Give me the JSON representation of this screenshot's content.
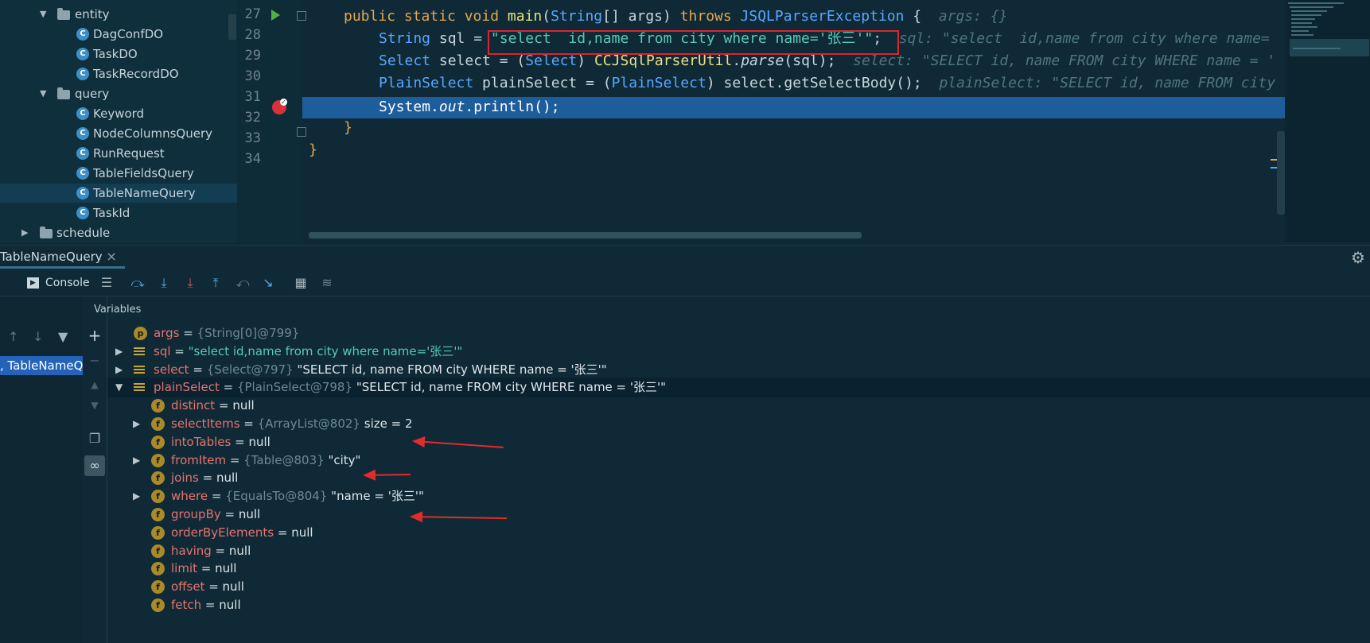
{
  "project_tree": {
    "nodes": [
      {
        "label": "entity",
        "kind": "folder",
        "expanded": true
      },
      {
        "label": "DagConfDO",
        "kind": "class"
      },
      {
        "label": "TaskDO",
        "kind": "class"
      },
      {
        "label": "TaskRecordDO",
        "kind": "class"
      },
      {
        "label": "query",
        "kind": "folder",
        "expanded": true
      },
      {
        "label": "Keyword",
        "kind": "class"
      },
      {
        "label": "NodeColumnsQuery",
        "kind": "class"
      },
      {
        "label": "RunRequest",
        "kind": "class"
      },
      {
        "label": "TableFieldsQuery",
        "kind": "class"
      },
      {
        "label": "TableNameQuery",
        "kind": "class",
        "selected": true
      },
      {
        "label": "TaskId",
        "kind": "class"
      },
      {
        "label": "schedule",
        "kind": "folder",
        "expanded": false
      }
    ]
  },
  "editor": {
    "line_numbers": [
      "27",
      "28",
      "29",
      "30",
      "31",
      "32",
      "33",
      "34"
    ],
    "line27": {
      "kw1": "public static void ",
      "fn": "main",
      "p1": "(",
      "ty": "String",
      "p2": "[] args) ",
      "kw2": "throws ",
      "exc": "JSQLParserException",
      "p3": " {",
      "hint": "args: {}"
    },
    "line28": {
      "ty": "String",
      "p1": " sql = ",
      "str": "\"select  id,name from city where name='张三'\"",
      "p2": ";",
      "hint": "sql: \"select  id,name from city where name="
    },
    "line29": {
      "ty": "Select",
      "p1": " select = (",
      "ty2": "Select",
      "p2": ") ",
      "cls": "CCJSqlParserUtil",
      "p3": ".",
      "m": "parse",
      "p4": "(sql);",
      "hint": "select: \"SELECT id, name FROM city WHERE name = '"
    },
    "line30": {
      "ty": "PlainSelect",
      "p1": " plainSelect = (",
      "ty2": "PlainSelect",
      "p2": ") select.getSelectBody();",
      "hint": "plainSelect: \"SELECT id, name FROM city"
    },
    "line31": {
      "p1": "System.",
      "out": "out",
      "p2": ".println();"
    },
    "line32": "}",
    "line33": "}"
  },
  "debug": {
    "tab_title": "TableNameQuery",
    "tab_close": "×",
    "console_label": "Console",
    "variables_header": "Variables",
    "frame_label": ", TableNameQ",
    "variables": [
      {
        "name": "args",
        "type": "{String[0]@799}",
        "value": "",
        "icon": "p",
        "expandable": false
      },
      {
        "name": "sql",
        "type": "",
        "value": "\"select  id,name from city where name='张三'\"",
        "icon": "local",
        "expandable": true,
        "is_string": true
      },
      {
        "name": "select",
        "type": "{Select@797}",
        "value": "\"SELECT id, name FROM city WHERE name = '张三'\"",
        "icon": "local",
        "expandable": true
      },
      {
        "name": "plainSelect",
        "type": "{PlainSelect@798}",
        "value": "\"SELECT id, name FROM city WHERE name = '张三'\"",
        "icon": "local",
        "expandable": true,
        "expanded": true,
        "selected": true
      },
      {
        "name": "distinct",
        "type": "",
        "value": "null",
        "icon": "f",
        "child": true
      },
      {
        "name": "selectItems",
        "type": "{ArrayList@802}",
        "value": " size = 2",
        "icon": "f",
        "child": true,
        "expandable": true
      },
      {
        "name": "intoTables",
        "type": "",
        "value": "null",
        "icon": "f",
        "child": true
      },
      {
        "name": "fromItem",
        "type": "{Table@803}",
        "value": "\"city\"",
        "icon": "f",
        "child": true,
        "expandable": true
      },
      {
        "name": "joins",
        "type": "",
        "value": "null",
        "icon": "f",
        "child": true
      },
      {
        "name": "where",
        "type": "{EqualsTo@804}",
        "value": "\"name = '张三'\"",
        "icon": "f",
        "child": true,
        "expandable": true
      },
      {
        "name": "groupBy",
        "type": "",
        "value": "null",
        "icon": "f",
        "child": true
      },
      {
        "name": "orderByElements",
        "type": "",
        "value": "null",
        "icon": "f",
        "child": true
      },
      {
        "name": "having",
        "type": "",
        "value": "null",
        "icon": "f",
        "child": true
      },
      {
        "name": "limit",
        "type": "",
        "value": "null",
        "icon": "f",
        "child": true
      },
      {
        "name": "offset",
        "type": "",
        "value": "null",
        "icon": "f",
        "child": true
      },
      {
        "name": "fetch",
        "type": "",
        "value": "null",
        "icon": "f",
        "child": true
      }
    ]
  },
  "colors": {
    "accent": "#2463b8",
    "current_line": "#1e5d9b",
    "annotation": "#e22b2b"
  }
}
